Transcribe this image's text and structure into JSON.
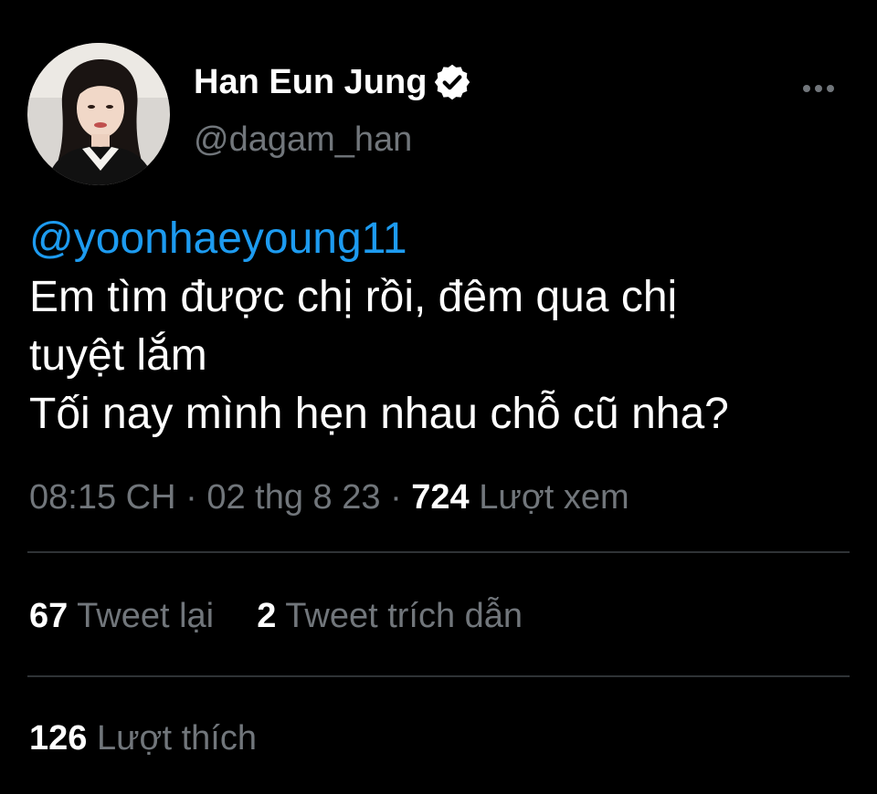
{
  "user": {
    "display_name": "Han Eun Jung",
    "handle": "@dagam_han",
    "avatar_icon": "profile-photo",
    "verified_icon": "verified-badge-icon"
  },
  "tweet": {
    "mention": "@yoonhaeyoung11",
    "lines": [
      "Em tìm được chị rồi, đêm qua chị",
      "tuyệt lắm",
      "Tối nay mình hẹn nhau chỗ cũ nha?"
    ]
  },
  "meta": {
    "time": "08:15 CH",
    "date": "02 thg 8 23",
    "views_count": "724",
    "views_label": "Lượt xem"
  },
  "stats": {
    "retweets_count": "67",
    "retweets_label": "Tweet lại",
    "quotes_count": "2",
    "quotes_label": "Tweet trích dẫn",
    "likes_count": "126",
    "likes_label": "Lượt thích"
  },
  "colors": {
    "background": "#000000",
    "text": "#ffffff",
    "secondary": "#71767b",
    "link": "#1d9bf0",
    "divider": "#2f3336"
  }
}
